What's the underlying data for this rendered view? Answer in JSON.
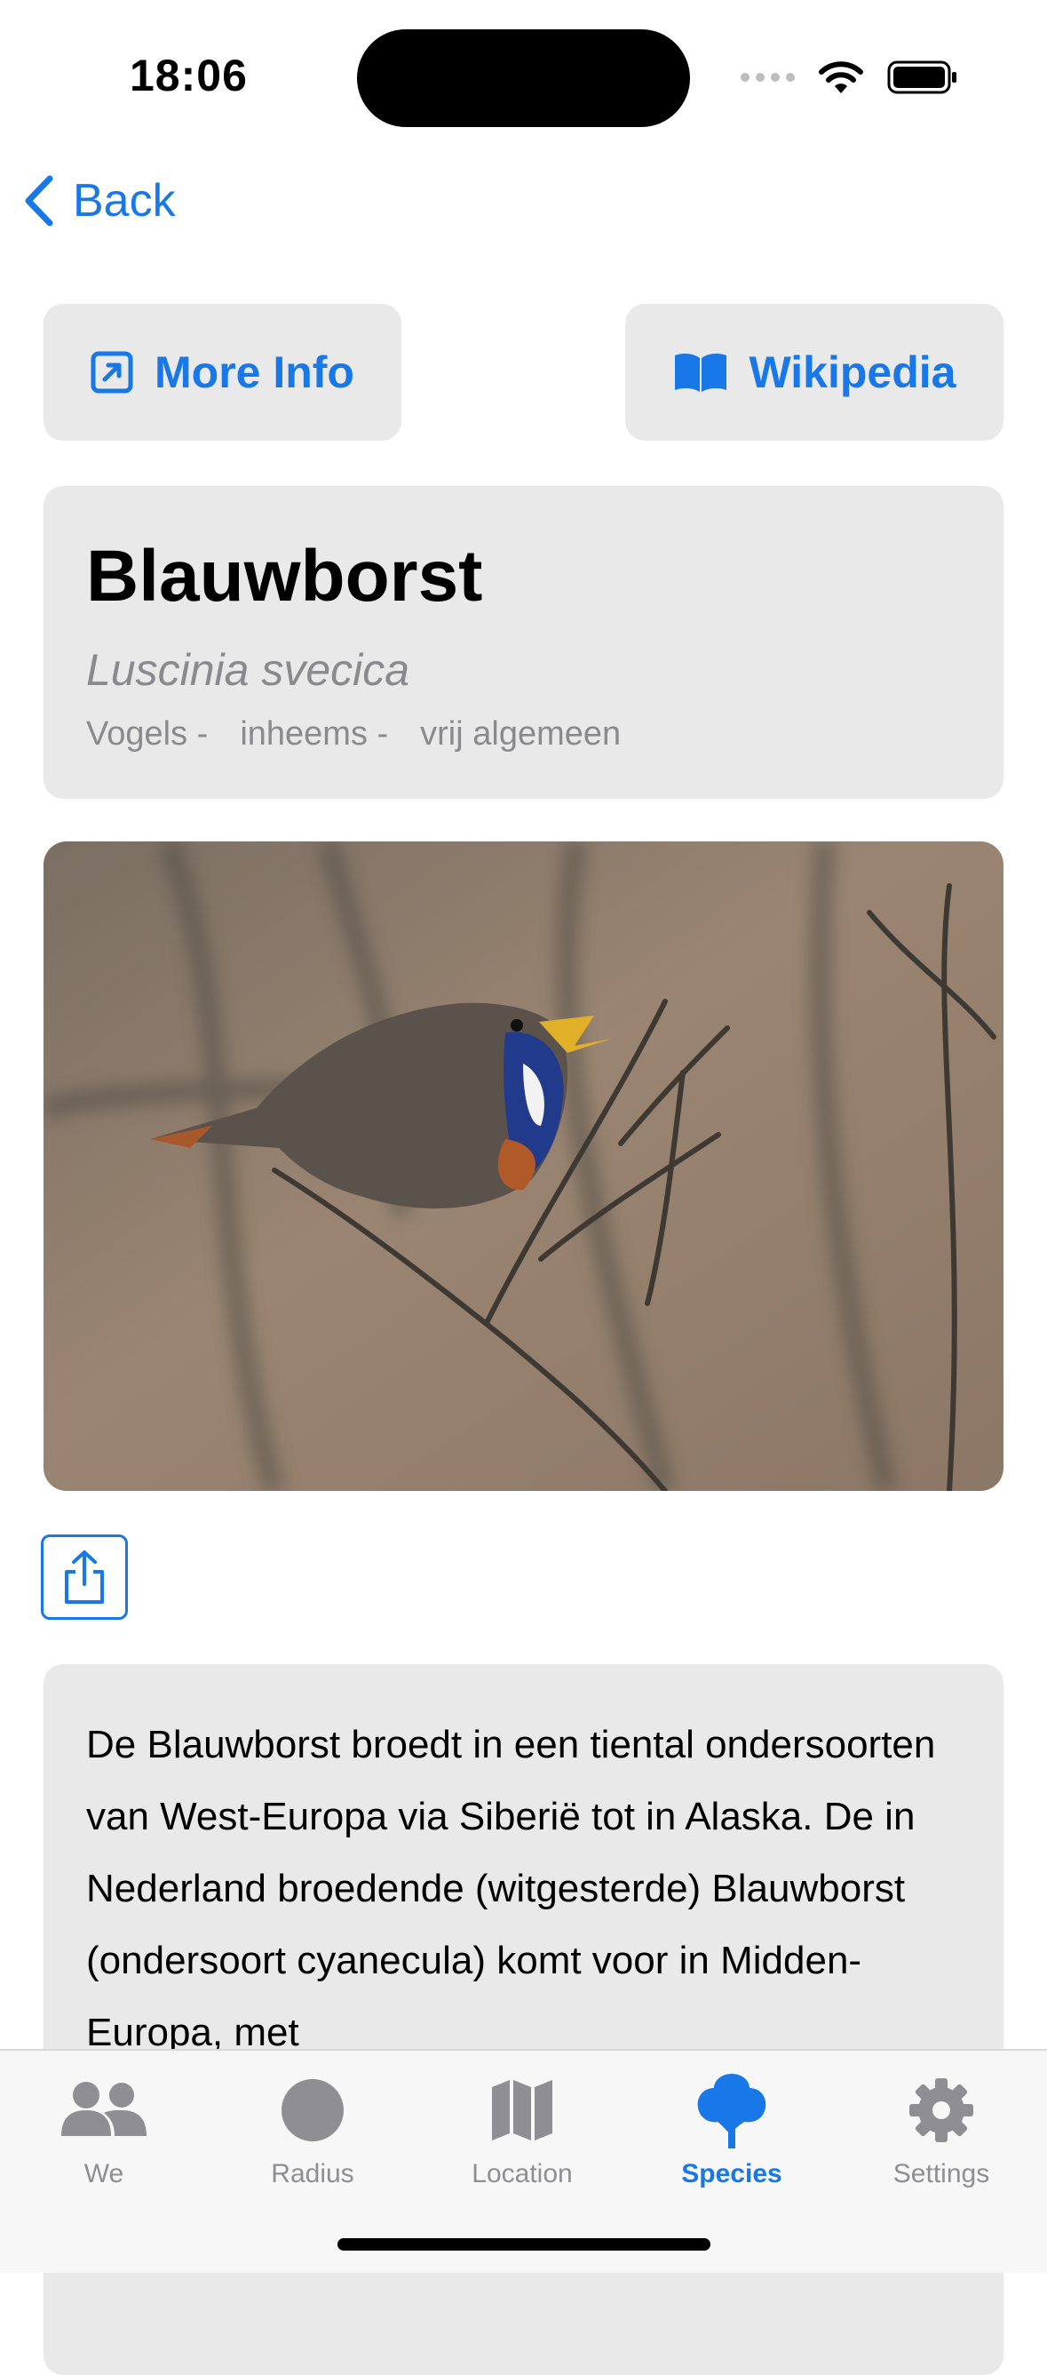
{
  "status_bar": {
    "time": "18:06"
  },
  "nav": {
    "back_label": "Back"
  },
  "actions": {
    "more_info_label": "More Info",
    "wikipedia_label": "Wikipedia"
  },
  "species": {
    "name": "Blauwborst",
    "latin": "Luscinia svecica",
    "tags": [
      "Vogels -",
      "inheems -",
      "vrij algemeen"
    ]
  },
  "description": "De Blauwborst broedt in een tiental ondersoorten van West-Europa via Siberië tot in Alaska. De in Nederland broedende (witgesterde) Blauwborst (ondersoort cyanecula) komt voor in Midden-Europa, met",
  "tabs": [
    {
      "label": "We",
      "icon": "people-icon",
      "active": false
    },
    {
      "label": "Radius",
      "icon": "circle-icon",
      "active": false
    },
    {
      "label": "Location",
      "icon": "map-icon",
      "active": false
    },
    {
      "label": "Species",
      "icon": "tree-icon",
      "active": true
    },
    {
      "label": "Settings",
      "icon": "gear-icon",
      "active": false
    }
  ],
  "colors": {
    "accent": "#1878e8",
    "card": "#e9e9ea",
    "secondary_text": "#8a8a8e"
  }
}
